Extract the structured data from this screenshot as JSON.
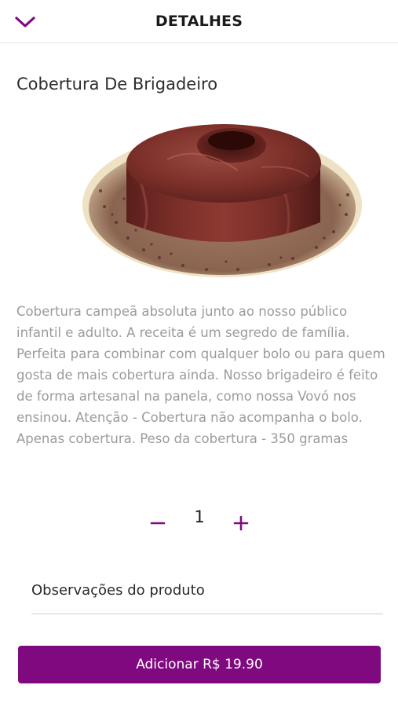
{
  "header": {
    "title": "DETALHES",
    "back_icon": "chevron-down-icon"
  },
  "product": {
    "title": "Cobertura De Brigadeiro",
    "image": "chocolate-brigadeiro-cake-photo",
    "description": "Cobertura campeã absoluta junto ao nosso público infantil e adulto. A receita é um segredo de família. Perfeita para combinar com qualquer bolo ou para quem gosta de mais cobertura ainda. Nosso brigadeiro é feito de forma artesanal na panela, como nossa Vovó nos ensinou. Atenção - Cobertura não acompanha o bolo. Apenas cobertura. Peso da cobertura - 350 gramas"
  },
  "quantity": {
    "value": "1",
    "minus_icon": "minus-icon",
    "plus_icon": "plus-icon"
  },
  "notes": {
    "label": "Observações do produto"
  },
  "add_button": {
    "label": "Adicionar R$ 19.90"
  },
  "colors": {
    "accent": "#7f0a80",
    "description_text": "#9b9b9b",
    "title_text": "#2e2e2e"
  }
}
